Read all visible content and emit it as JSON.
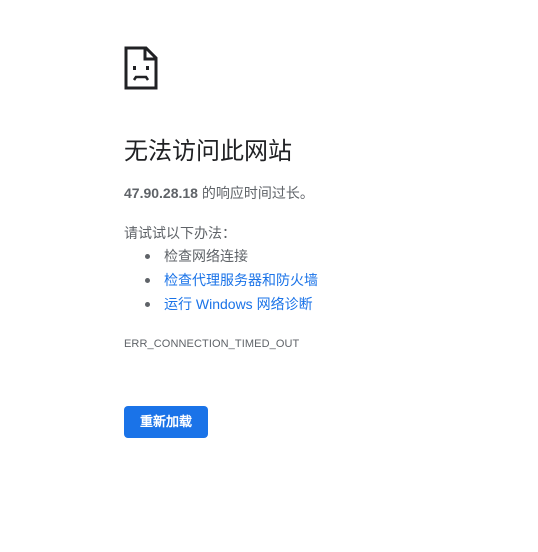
{
  "icon": "sad-page-icon",
  "headline": "无法访问此网站",
  "summary": {
    "host": "47.90.28.18",
    "text": " 的响应时间过长。"
  },
  "suggestions": {
    "title": "请试试以下办法：",
    "items": [
      {
        "label": "检查网络连接",
        "link": false
      },
      {
        "label": "检查代理服务器和防火墙",
        "link": true
      },
      {
        "label": "运行 Windows 网络诊断",
        "link": true
      }
    ]
  },
  "error_code": "ERR_CONNECTION_TIMED_OUT",
  "reload_button": "重新加载",
  "colors": {
    "link": "#1a73e8",
    "button": "#1a73e8",
    "text": "#5f6368",
    "headline": "#202124"
  }
}
